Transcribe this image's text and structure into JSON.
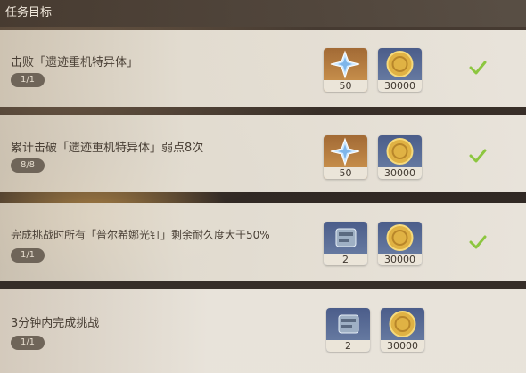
{
  "header": {
    "title": "任务目标"
  },
  "tasks": [
    {
      "title": "击败「遗迹重机特异体」",
      "progress": "1/1",
      "reward1": {
        "icon": "primogem-icon",
        "qty": "50"
      },
      "reward2": {
        "icon": "mora-coin-icon",
        "qty": "30000"
      },
      "completed": true
    },
    {
      "title": "累计击破「遗迹重机特异体」弱点8次",
      "progress": "8/8",
      "reward1": {
        "icon": "primogem-icon",
        "qty": "50"
      },
      "reward2": {
        "icon": "mora-coin-icon",
        "qty": "30000"
      },
      "completed": true
    },
    {
      "title": "完成挑战时所有「普尔希娜光钉」剩余耐久度大于50%",
      "progress": "1/1",
      "reward1": {
        "icon": "hero-wit-icon",
        "qty": "2"
      },
      "reward2": {
        "icon": "mora-coin-icon",
        "qty": "30000"
      },
      "completed": true
    },
    {
      "title": "3分钟内完成挑战",
      "progress": "1/1",
      "reward1": {
        "icon": "hero-wit-icon",
        "qty": "2"
      },
      "reward2": {
        "icon": "mora-coin-icon",
        "qty": "30000"
      },
      "completed": false
    }
  ],
  "colors": {
    "check": "#8cc63f",
    "progress_bg": "#6f6559",
    "row_bg": "#ece7dd"
  }
}
